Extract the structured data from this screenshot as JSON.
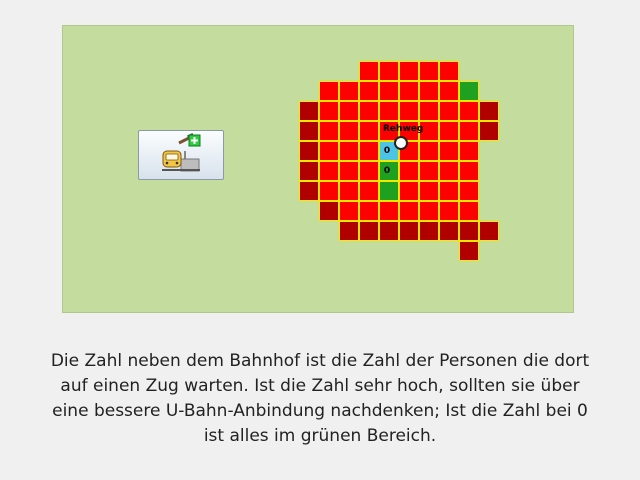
{
  "map": {
    "station_name": "Rehweg",
    "colors": {
      "background": "#c4dc9e",
      "red": "#ff0000",
      "dark": "#b00000",
      "green": "#20a020",
      "cyan": "#4cc4e8",
      "border": "#f5e800"
    },
    "grid_rows": [
      "...RRRRR...",
      ".RRRRRRRG..",
      "DRRRRRRRRD.",
      "DRRRRRRRRD.",
      "DRRRCRRRR..",
      "DRRRGRRRR..",
      "DRRRGRRRR..",
      ".DRRRRRRR..",
      "..DDDDDDDD.",
      "........D.."
    ],
    "queue_labels": [
      {
        "row": 4,
        "col": 4,
        "text": "0"
      },
      {
        "row": 5,
        "col": 4,
        "text": "0"
      }
    ]
  },
  "toolbar": {
    "build_station_icon": "train-station-build-icon"
  },
  "caption": {
    "text": "Die Zahl neben dem Bahnhof ist die Zahl der Personen die dort auf einen Zug warten. Ist die Zahl sehr hoch, sollten sie über eine bessere U-Bahn-Anbindung nachdenken; Ist die Zahl bei 0 ist alles im grünen Bereich."
  }
}
